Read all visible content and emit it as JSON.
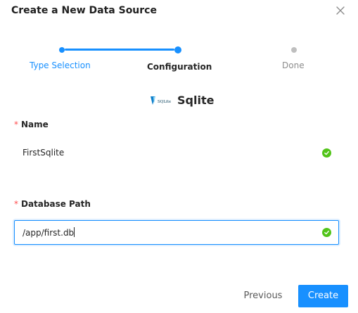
{
  "dialog": {
    "title": "Create a New Data Source"
  },
  "steps": [
    {
      "label": "Type Selection",
      "status": "finished"
    },
    {
      "label": "Configuration",
      "status": "current"
    },
    {
      "label": "Done",
      "status": "waiting"
    }
  ],
  "source": {
    "logo_text": "SQLite",
    "name": "Sqlite"
  },
  "form": {
    "name": {
      "label": "Name",
      "required_mark": "*",
      "value": "FirstSqlite",
      "valid": true
    },
    "database_path": {
      "label": "Database Path",
      "required_mark": "*",
      "value": "/app/first.db",
      "valid": true
    }
  },
  "footer": {
    "previous_label": "Previous",
    "create_label": "Create"
  },
  "colors": {
    "primary": "#1890ff",
    "success": "#52c41a",
    "required": "#ff4d4f"
  }
}
